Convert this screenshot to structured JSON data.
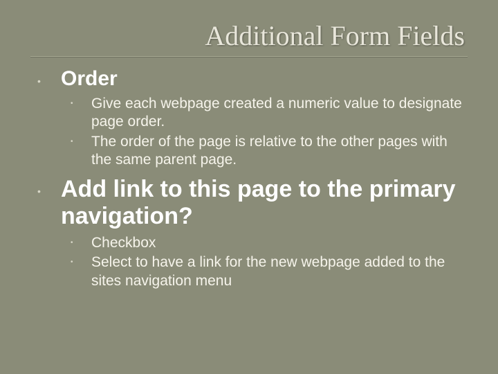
{
  "title": "Additional Form Fields",
  "sections": [
    {
      "heading": "Order",
      "items": [
        "Give each webpage created a numeric value to designate page order.",
        "The order of the page is relative to the other pages with the same parent page."
      ]
    },
    {
      "heading": "Add link to this page to the primary navigation?",
      "items": [
        "Checkbox",
        "Select to have a link for the new webpage added to the sites navigation menu"
      ]
    }
  ]
}
